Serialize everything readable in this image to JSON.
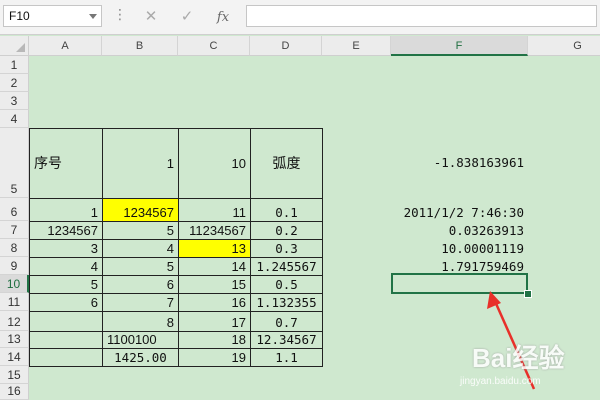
{
  "formula_bar": {
    "name_box": "F10",
    "dots": "⋮",
    "cancel_glyph": "✕",
    "enter_glyph": "✓",
    "fx_label": "fx",
    "formula": ""
  },
  "columns": [
    "A",
    "B",
    "C",
    "D",
    "E",
    "F",
    "G"
  ],
  "rows": [
    "1",
    "2",
    "3",
    "4",
    "5",
    "6",
    "7",
    "8",
    "9",
    "10",
    "11",
    "12",
    "13",
    "14",
    "15",
    "16"
  ],
  "cells": {
    "A5": "序号",
    "B5": "1",
    "C5": "10",
    "D5": "弧度",
    "F5": "-1.838163961",
    "A6": "1",
    "B6": "1234567",
    "C6": "11",
    "D6": "0.1",
    "F6": "2011/1/2 7:46:30",
    "A7": "1234567",
    "B7": "5",
    "C7": "11234567",
    "D7": "0.2",
    "F7": "0.03263913",
    "A8": "3",
    "B8": "4",
    "C8": "13",
    "D8": "0.3",
    "F8": "10.00001119",
    "A9": "4",
    "B9": "5",
    "C9": "14",
    "D9": "1.245567",
    "F9": "1.791759469",
    "A10": "5",
    "B10": "6",
    "C10": "15",
    "D10": "0.5",
    "A11": "6",
    "B11": "7",
    "C11": "16",
    "D11": "1.132355",
    "B12": "8",
    "C12": "17",
    "D12": "0.7",
    "B13": "1100100",
    "C13": "18",
    "D13": "12.34567",
    "B14": "1425.00",
    "C14": "19",
    "D14": "1.1"
  },
  "selected_cell": "F10",
  "colors": {
    "sheet_bg": "#cfe8cf",
    "highlight": "#ffff00",
    "selection": "#217346",
    "arrow": "#e8302a"
  },
  "watermark": {
    "text": "Bai经验",
    "url": "jingyan.baidu.com"
  }
}
